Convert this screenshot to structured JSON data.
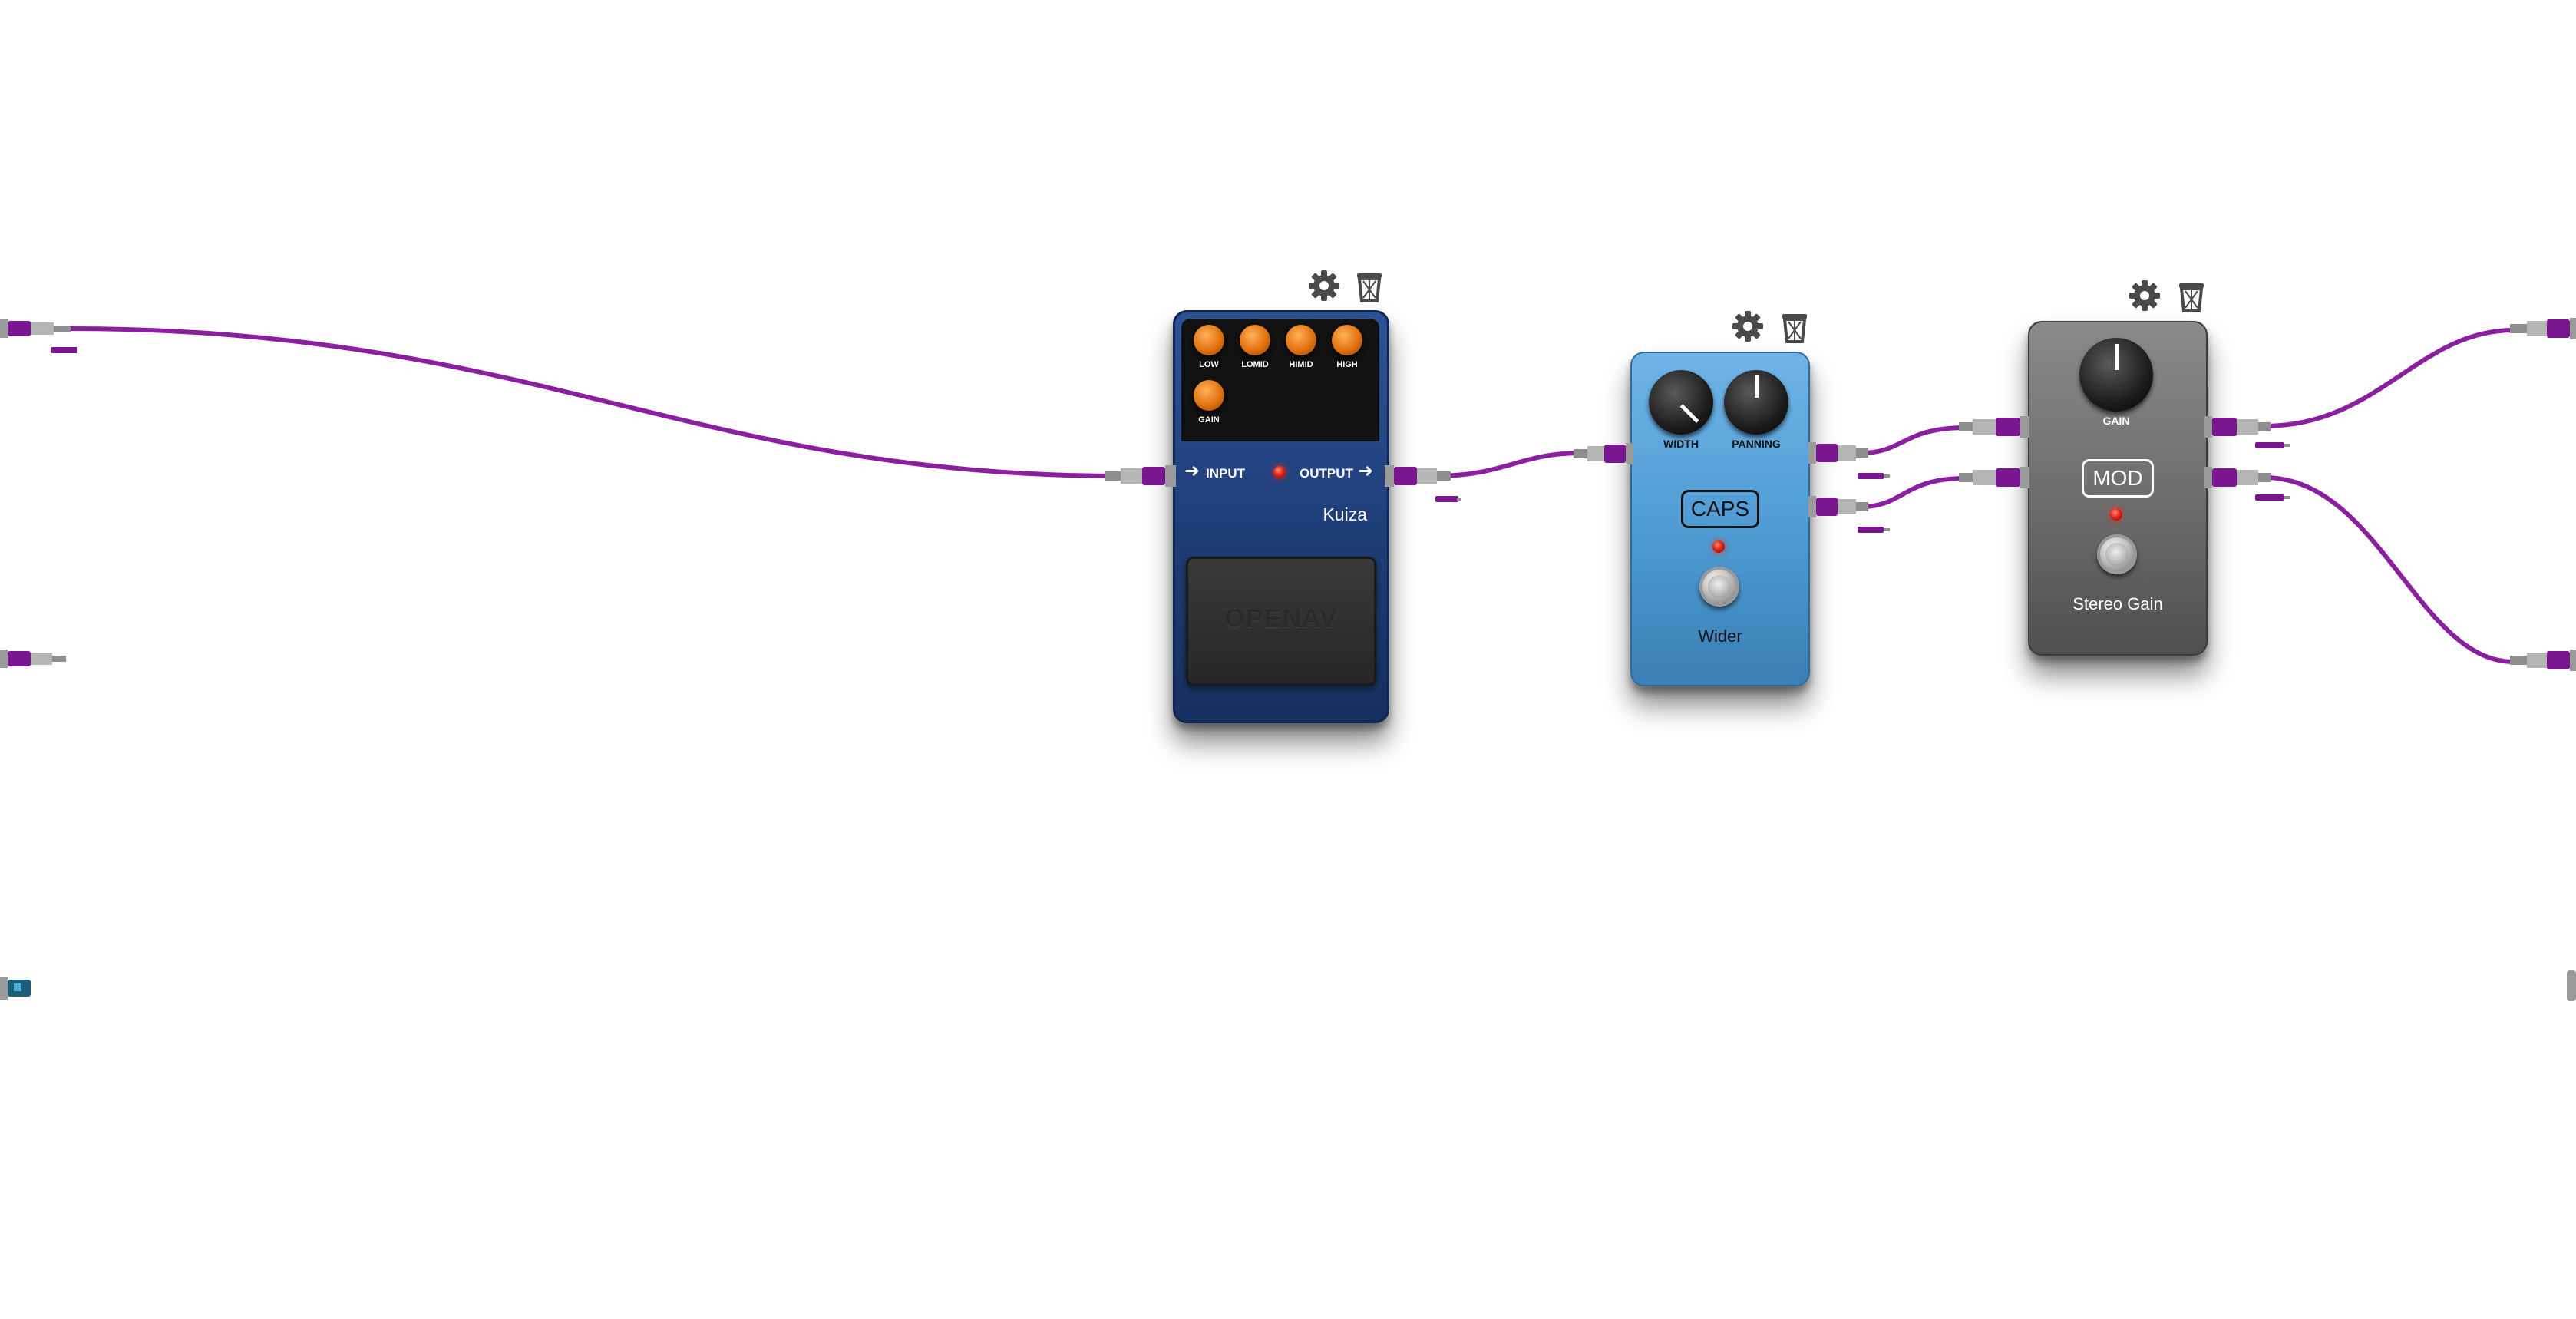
{
  "app": {
    "background_color": "#ffffff",
    "cable_color": "#8a1fa0"
  },
  "pedals": {
    "kuiza": {
      "name": "Kuiza",
      "brand": "OPENAV",
      "input_label": "INPUT",
      "output_label": "OUTPUT",
      "knobs": [
        "LOW",
        "LOMID",
        "HIMID",
        "HIGH",
        "GAIN"
      ],
      "knob_color": "#e2720f",
      "body_color": "#1f3f7a"
    },
    "wider": {
      "name": "Wider",
      "brand": "CAPS",
      "knobs": [
        "WIDTH",
        "PANNING"
      ],
      "body_color": "#4e9ad3"
    },
    "stereo_gain": {
      "name": "Stereo Gain",
      "brand": "MOD",
      "knobs": [
        "GAIN"
      ],
      "body_color": "#6c6c6c"
    }
  },
  "icons": {
    "settings": "gear-icon",
    "remove": "trash-icon"
  }
}
